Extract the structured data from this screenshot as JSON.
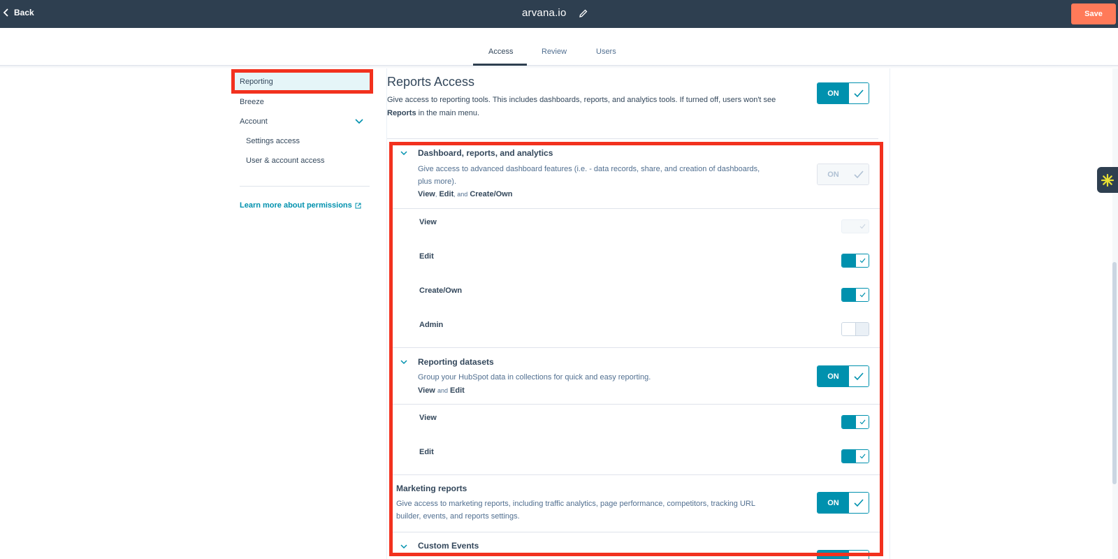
{
  "header": {
    "back_label": "Back",
    "title": "arvana.io",
    "save_label": "Save"
  },
  "tabs": [
    {
      "label": "Access",
      "active": true
    },
    {
      "label": "Review",
      "active": false
    },
    {
      "label": "Users",
      "active": false
    }
  ],
  "sidebar": {
    "items": [
      {
        "label": "Reporting",
        "selected": true
      },
      {
        "label": "Breeze"
      },
      {
        "label": "Account",
        "expandable": true
      },
      {
        "label": "Settings access"
      },
      {
        "label": "User & account access"
      }
    ],
    "learn_more": "Learn more about permissions"
  },
  "main": {
    "title": "Reports Access",
    "description_pre": "Give access to reporting tools. This includes dashboards, reports, and analytics tools. If turned off, users won't see",
    "description_bold": "Reports",
    "description_post": "in the main menu.",
    "toggle_label": "ON"
  },
  "sections": {
    "dashboard": {
      "title": "Dashboard, reports, and analytics",
      "description": "Give access to advanced dashboard features (i.e. - data records, share, and creation of dashboards, plus more).",
      "link1": "View",
      "sep1": ",",
      "link2": "Edit",
      "sep2": ", and",
      "link3": "Create/Own",
      "toggle_label": "ON",
      "permissions": [
        {
          "label": "View",
          "state": "disabled"
        },
        {
          "label": "Edit",
          "state": "on"
        },
        {
          "label": "Create/Own",
          "state": "on"
        },
        {
          "label": "Admin",
          "state": "off"
        }
      ]
    },
    "datasets": {
      "title": "Reporting datasets",
      "description": "Group your HubSpot data in collections for quick and easy reporting.",
      "link1": "View",
      "sep1": "and",
      "link2": "Edit",
      "toggle_label": "ON",
      "permissions": [
        {
          "label": "View",
          "state": "on"
        },
        {
          "label": "Edit",
          "state": "on"
        }
      ]
    },
    "marketing": {
      "title": "Marketing reports",
      "description": "Give access to marketing reports, including traffic analytics, page performance, competitors, tracking URL builder, events, and reports settings.",
      "toggle_label": "ON"
    },
    "custom_events": {
      "title": "Custom Events"
    }
  },
  "colors": {
    "header_bg": "#2e3f50",
    "accent": "#0091ae",
    "save_bg": "#ff7a59",
    "highlight_border": "#f2311e"
  }
}
